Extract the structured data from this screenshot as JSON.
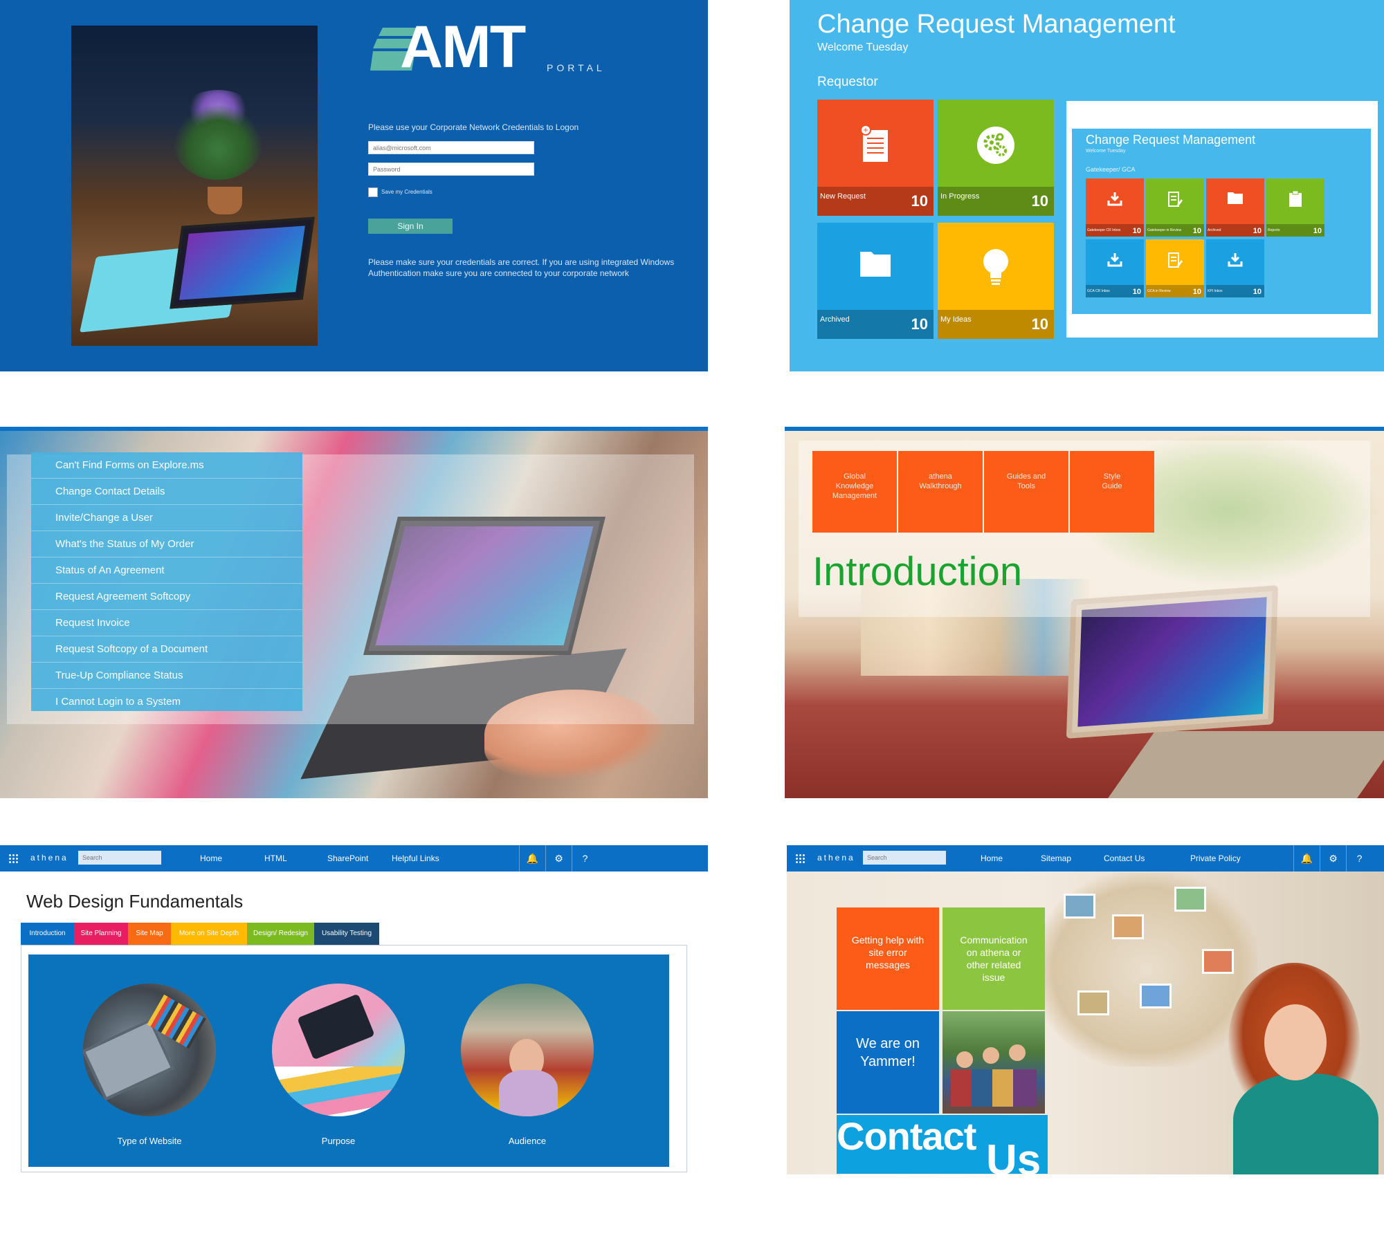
{
  "login": {
    "logo": "AMT",
    "logo_sub": "PORTAL",
    "prompt": "Please use your Corporate Network Credentials to Logon",
    "username_placeholder": "alias@microsoft.com",
    "password_placeholder": "Password",
    "remember_label": "Save my Credentials",
    "signin_label": "Sign In",
    "note": "Please make sure your credentials are correct. If you are using integrated Windows Authentication make sure you are connected to your corporate network"
  },
  "crm": {
    "title": "Change Request Management",
    "welcome": "Welcome Tuesday",
    "section": "Requestor",
    "tiles": [
      {
        "label": "New Request",
        "count": "10",
        "color": "#f04e23",
        "icon": "document-icon"
      },
      {
        "label": "In Progress",
        "count": "10",
        "color": "#7cbb1f",
        "icon": "gears-icon"
      },
      {
        "label": "Archived",
        "count": "10",
        "color": "#1ba1e2",
        "icon": "folder-icon"
      },
      {
        "label": "My Ideas",
        "count": "10",
        "color": "#ffb900",
        "icon": "lightbulb-icon"
      }
    ],
    "inner": {
      "title": "Change Request Management",
      "welcome": "Welcome Tuesday",
      "group": "Gatekeeper/ GCA",
      "tiles": [
        {
          "label": "Gatekeeper CR Inbox",
          "count": "10",
          "color": "#f04e23",
          "icon": "download-icon"
        },
        {
          "label": "Gatekeeper in Review",
          "count": "10",
          "color": "#7cbb1f",
          "icon": "edit-document-icon"
        },
        {
          "label": "Archived",
          "count": "10",
          "color": "#f04e23",
          "icon": "folder-icon"
        },
        {
          "label": "Reports",
          "count": "10",
          "color": "#7cbb1f",
          "icon": "clipboard-icon"
        },
        {
          "label": "GCA CR Inbox",
          "count": "10",
          "color": "#1ba1e2",
          "icon": "download-icon"
        },
        {
          "label": "GCA in Review",
          "count": "10",
          "color": "#ffb900",
          "icon": "edit-document-icon"
        },
        {
          "label": "KPI Inbox",
          "count": "10",
          "color": "#1ba1e2",
          "icon": "download-icon"
        }
      ]
    }
  },
  "help_menu": {
    "items": [
      "Can't Find Forms on Explore.ms",
      "Change Contact Details",
      "Invite/Change a User",
      "What's the Status of My Order",
      "Status of An Agreement",
      "Request Agreement Softcopy",
      "Request Invoice",
      "Request Softcopy of a Document",
      "True-Up Compliance Status",
      "I Cannot Login to a System"
    ]
  },
  "intro": {
    "tiles": [
      {
        "l1": "Global",
        "l2": "Knowledge",
        "l3": "Management"
      },
      {
        "l1": "athena",
        "l2": "Walkthrough",
        "l3": ""
      },
      {
        "l1": "Guides and",
        "l2": "Tools",
        "l3": ""
      },
      {
        "l1": "Style",
        "l2": "Guide",
        "l3": ""
      }
    ],
    "heading": "Introduction"
  },
  "webdesign": {
    "bar": {
      "brand": "athena",
      "search_placeholder": "Search",
      "nav": [
        "Home",
        "HTML",
        "SharePoint",
        "Helpful Links"
      ]
    },
    "title": "Web Design Fundamentals",
    "tabs": [
      {
        "label": "Introduction",
        "color": "#0b6fc6"
      },
      {
        "label": "Site Planning",
        "color": "#e81d62"
      },
      {
        "label": "Site Map",
        "color": "#f96a14"
      },
      {
        "label": "More on Site Depth",
        "color": "#ffb900"
      },
      {
        "label": "Design/ Redesign",
        "color": "#7cbb1f"
      },
      {
        "label": "Usability Testing",
        "color": "#1c4a73"
      }
    ],
    "circles": [
      "Type of Website",
      "Purpose",
      "Audience"
    ]
  },
  "contact": {
    "bar": {
      "brand": "athena",
      "search_placeholder": "Search",
      "nav": [
        "Home",
        "Sitemap",
        "Contact Us",
        "Private Policy"
      ]
    },
    "tiles": [
      {
        "text": "Getting help with site error messages",
        "color": "#fb5d18"
      },
      {
        "text": "Communication on athena or other related issue",
        "color": "#8cc53f"
      },
      {
        "text": "We are on Yammer!",
        "color": "#0b6fc6"
      }
    ],
    "contact_word": "Contact",
    "us_word": "Us"
  }
}
